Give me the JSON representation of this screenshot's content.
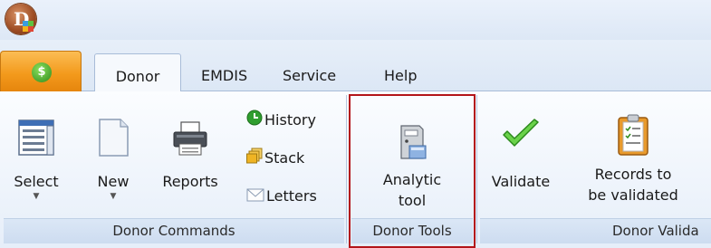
{
  "tabs": [
    {
      "label": "Donor",
      "active": true
    },
    {
      "label": "EMDIS",
      "active": false
    },
    {
      "label": "Service",
      "active": false
    },
    {
      "label": "Help",
      "active": false
    }
  ],
  "groups": {
    "donor_commands": {
      "title": "Donor Commands",
      "buttons": {
        "select": "Select",
        "new": "New",
        "reports": "Reports",
        "history": "History",
        "stack": "Stack",
        "letters": "Letters"
      }
    },
    "donor_tools": {
      "title": "Donor Tools",
      "analytic_line1": "Analytic",
      "analytic_line2": "tool"
    },
    "donor_validation": {
      "title": "Donor Valida",
      "validate": "Validate",
      "records_line1": "Records to",
      "records_line2": "be validated"
    }
  },
  "colors": {
    "app_button": "#f39a1c",
    "highlight_border": "#b3151a",
    "ribbon_bg": "#e6eef9"
  },
  "icons": [
    "app-logo-icon",
    "app-menu-icon",
    "select-icon",
    "new-document-icon",
    "printer-icon",
    "history-icon",
    "stack-icon",
    "letters-icon",
    "analytic-tool-icon",
    "checkmark-icon",
    "clipboard-icon"
  ]
}
